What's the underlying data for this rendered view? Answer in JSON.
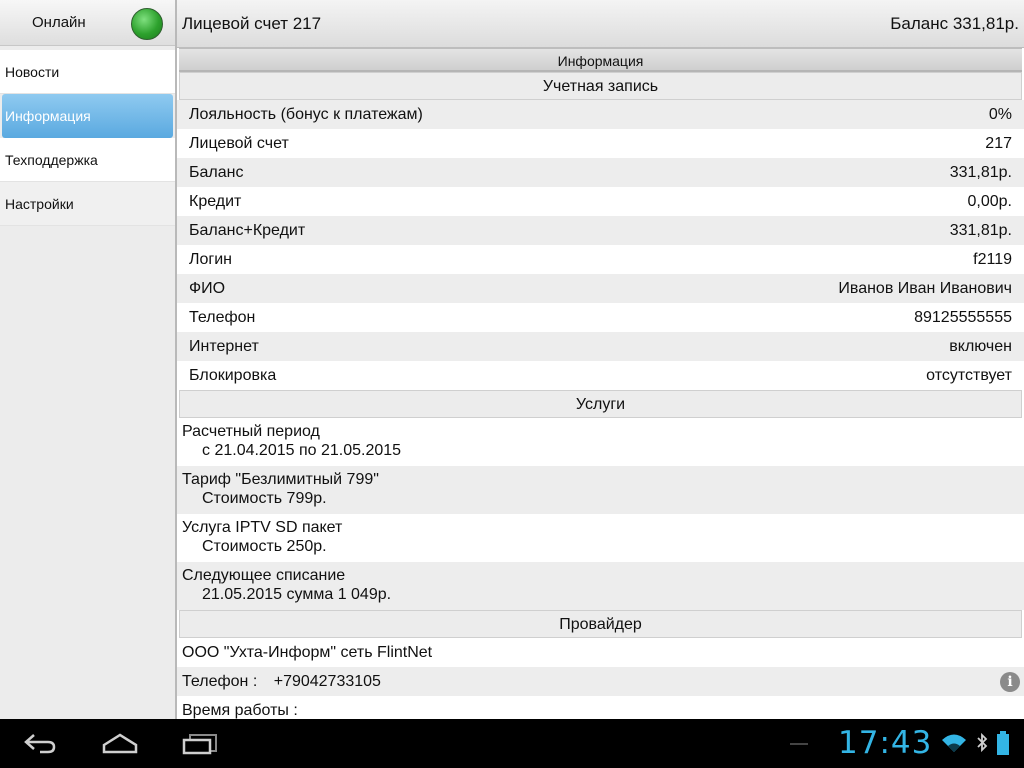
{
  "sidebar": {
    "status_label": "Онлайн",
    "status_color": "#2da12d",
    "items": [
      {
        "label": "Новости",
        "active": false
      },
      {
        "label": "Информация",
        "active": true
      },
      {
        "label": "Техподдержка",
        "active": false
      },
      {
        "label": "Настройки",
        "active": false
      }
    ]
  },
  "header": {
    "account": "Лицевой счет 217",
    "balance": "Баланс 331,81р."
  },
  "content": {
    "tab_title": "Информация",
    "account_section": {
      "title": "Учетная запись",
      "rows": [
        {
          "key": "Лояльность (бонус к платежам)",
          "value": "0%"
        },
        {
          "key": "Лицевой счет",
          "value": "217"
        },
        {
          "key": "Баланс",
          "value": "331,81р."
        },
        {
          "key": "Кредит",
          "value": "0,00р."
        },
        {
          "key": "Баланс+Кредит",
          "value": "331,81р."
        },
        {
          "key": "Логин",
          "value": "f2119"
        },
        {
          "key": "ФИО",
          "value": "Иванов Иван Иванович"
        },
        {
          "key": "Телефон",
          "value": "89125555555"
        },
        {
          "key": "Интернет",
          "value": "включен"
        },
        {
          "key": "Блокировка",
          "value": "отсутствует"
        }
      ]
    },
    "services_section": {
      "title": "Услуги",
      "items": [
        {
          "title": "Расчетный период",
          "detail": "с 21.04.2015 по 21.05.2015"
        },
        {
          "title": "Тариф \"Безлимитный 799\"",
          "detail": "Стоимость 799р."
        },
        {
          "title": "Услуга IPTV SD пакет",
          "detail": "Стоимость 250р."
        },
        {
          "title": "Следующее списание",
          "detail": "21.05.2015 сумма 1 049р."
        }
      ]
    },
    "provider_section": {
      "title": "Провайдер",
      "name": "ООО \"Ухта-Информ\" сеть FlintNet",
      "phone_label": "Телефон :",
      "phone_value": "+79042733105",
      "hours_label": "Время работы :"
    }
  },
  "system_bar": {
    "clock": "17:43",
    "accent_color": "#33b5e5",
    "icons": [
      "back-icon",
      "home-icon",
      "recent-apps-icon",
      "wifi-icon",
      "bluetooth-icon",
      "battery-icon"
    ]
  }
}
